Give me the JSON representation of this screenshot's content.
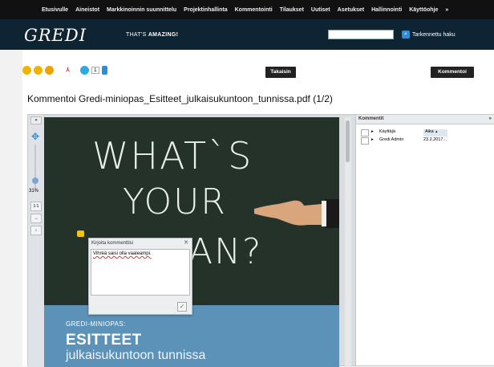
{
  "nav": {
    "items": [
      "Etusivulle",
      "Aineistot",
      "Markkinoinnin suunnittelu",
      "Projektinhallinta",
      "Kommentointi",
      "Tilaukset",
      "Uutiset",
      "Asetukset",
      "Hallinnointi",
      "Käyttöohje",
      "»"
    ]
  },
  "header": {
    "logo": "GREDI",
    "tagline_prefix": "THAT'S",
    "tagline_bold": "AMAZING!",
    "search_placeholder": "",
    "advanced_search": "Tarkennettu haku"
  },
  "toolbar": {
    "badge_count": "1",
    "back_label": "Takaisin",
    "comment_label": "Kommentoi"
  },
  "page": {
    "title": "Kommentoi Gredi-miniopas_Esitteet_julkaisukuntoon_tunnissa.pdf (1/2)"
  },
  "viewer": {
    "zoom": "31%",
    "fit_label": "1:1"
  },
  "document": {
    "line1": "WHAT`S",
    "line2": "YOUR",
    "line3": "AN?",
    "brand": "GREDI-MINIOPAS:",
    "heading": "ESITTEET",
    "subheading": "julkaisukuntoon tunnissa"
  },
  "comments_panel": {
    "title": "Kommentit",
    "col_user": "Käyttäjä",
    "col_time": "Aika",
    "sort_indicator": "▲",
    "rows": [
      {
        "user": "Gredi Admin",
        "time": "23.2.2017..."
      }
    ]
  },
  "dialog": {
    "title": "Kirjoita kommenttisi",
    "text": "Vihreä saisi olla vaaleampi."
  },
  "colors": {
    "nav_bg": "#111111",
    "header_bg": "#0e2433",
    "chalkboard": "#25322a",
    "doc_blue": "#5c92b8"
  }
}
